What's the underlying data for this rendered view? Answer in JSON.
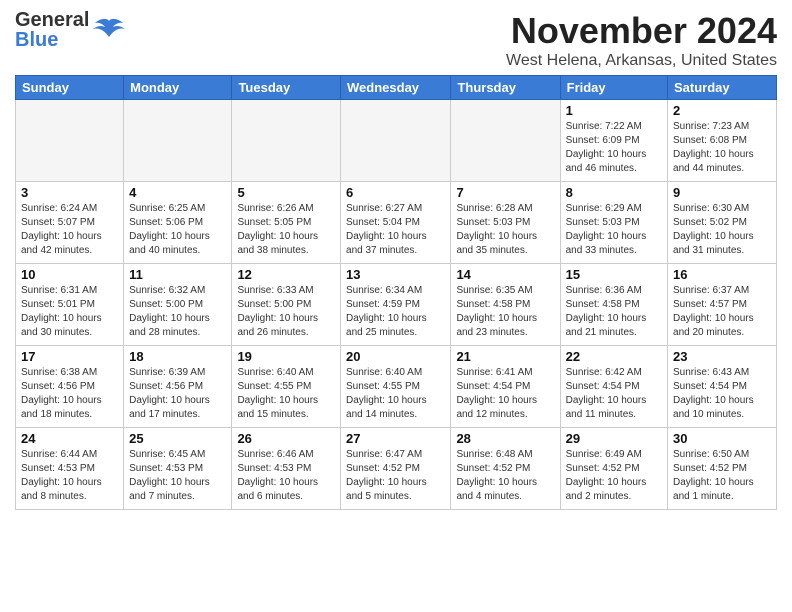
{
  "header": {
    "logo_general": "General",
    "logo_blue": "Blue",
    "month_title": "November 2024",
    "location": "West Helena, Arkansas, United States"
  },
  "weekdays": [
    "Sunday",
    "Monday",
    "Tuesday",
    "Wednesday",
    "Thursday",
    "Friday",
    "Saturday"
  ],
  "weeks": [
    [
      {
        "day": "",
        "empty": true
      },
      {
        "day": "",
        "empty": true
      },
      {
        "day": "",
        "empty": true
      },
      {
        "day": "",
        "empty": true
      },
      {
        "day": "",
        "empty": true
      },
      {
        "day": "1",
        "info": "Sunrise: 7:22 AM\nSunset: 6:09 PM\nDaylight: 10 hours\nand 46 minutes."
      },
      {
        "day": "2",
        "info": "Sunrise: 7:23 AM\nSunset: 6:08 PM\nDaylight: 10 hours\nand 44 minutes."
      }
    ],
    [
      {
        "day": "3",
        "info": "Sunrise: 6:24 AM\nSunset: 5:07 PM\nDaylight: 10 hours\nand 42 minutes."
      },
      {
        "day": "4",
        "info": "Sunrise: 6:25 AM\nSunset: 5:06 PM\nDaylight: 10 hours\nand 40 minutes."
      },
      {
        "day": "5",
        "info": "Sunrise: 6:26 AM\nSunset: 5:05 PM\nDaylight: 10 hours\nand 38 minutes."
      },
      {
        "day": "6",
        "info": "Sunrise: 6:27 AM\nSunset: 5:04 PM\nDaylight: 10 hours\nand 37 minutes."
      },
      {
        "day": "7",
        "info": "Sunrise: 6:28 AM\nSunset: 5:03 PM\nDaylight: 10 hours\nand 35 minutes."
      },
      {
        "day": "8",
        "info": "Sunrise: 6:29 AM\nSunset: 5:03 PM\nDaylight: 10 hours\nand 33 minutes."
      },
      {
        "day": "9",
        "info": "Sunrise: 6:30 AM\nSunset: 5:02 PM\nDaylight: 10 hours\nand 31 minutes."
      }
    ],
    [
      {
        "day": "10",
        "info": "Sunrise: 6:31 AM\nSunset: 5:01 PM\nDaylight: 10 hours\nand 30 minutes."
      },
      {
        "day": "11",
        "info": "Sunrise: 6:32 AM\nSunset: 5:00 PM\nDaylight: 10 hours\nand 28 minutes."
      },
      {
        "day": "12",
        "info": "Sunrise: 6:33 AM\nSunset: 5:00 PM\nDaylight: 10 hours\nand 26 minutes."
      },
      {
        "day": "13",
        "info": "Sunrise: 6:34 AM\nSunset: 4:59 PM\nDaylight: 10 hours\nand 25 minutes."
      },
      {
        "day": "14",
        "info": "Sunrise: 6:35 AM\nSunset: 4:58 PM\nDaylight: 10 hours\nand 23 minutes."
      },
      {
        "day": "15",
        "info": "Sunrise: 6:36 AM\nSunset: 4:58 PM\nDaylight: 10 hours\nand 21 minutes."
      },
      {
        "day": "16",
        "info": "Sunrise: 6:37 AM\nSunset: 4:57 PM\nDaylight: 10 hours\nand 20 minutes."
      }
    ],
    [
      {
        "day": "17",
        "info": "Sunrise: 6:38 AM\nSunset: 4:56 PM\nDaylight: 10 hours\nand 18 minutes."
      },
      {
        "day": "18",
        "info": "Sunrise: 6:39 AM\nSunset: 4:56 PM\nDaylight: 10 hours\nand 17 minutes."
      },
      {
        "day": "19",
        "info": "Sunrise: 6:40 AM\nSunset: 4:55 PM\nDaylight: 10 hours\nand 15 minutes."
      },
      {
        "day": "20",
        "info": "Sunrise: 6:40 AM\nSunset: 4:55 PM\nDaylight: 10 hours\nand 14 minutes."
      },
      {
        "day": "21",
        "info": "Sunrise: 6:41 AM\nSunset: 4:54 PM\nDaylight: 10 hours\nand 12 minutes."
      },
      {
        "day": "22",
        "info": "Sunrise: 6:42 AM\nSunset: 4:54 PM\nDaylight: 10 hours\nand 11 minutes."
      },
      {
        "day": "23",
        "info": "Sunrise: 6:43 AM\nSunset: 4:54 PM\nDaylight: 10 hours\nand 10 minutes."
      }
    ],
    [
      {
        "day": "24",
        "info": "Sunrise: 6:44 AM\nSunset: 4:53 PM\nDaylight: 10 hours\nand 8 minutes."
      },
      {
        "day": "25",
        "info": "Sunrise: 6:45 AM\nSunset: 4:53 PM\nDaylight: 10 hours\nand 7 minutes."
      },
      {
        "day": "26",
        "info": "Sunrise: 6:46 AM\nSunset: 4:53 PM\nDaylight: 10 hours\nand 6 minutes."
      },
      {
        "day": "27",
        "info": "Sunrise: 6:47 AM\nSunset: 4:52 PM\nDaylight: 10 hours\nand 5 minutes."
      },
      {
        "day": "28",
        "info": "Sunrise: 6:48 AM\nSunset: 4:52 PM\nDaylight: 10 hours\nand 4 minutes."
      },
      {
        "day": "29",
        "info": "Sunrise: 6:49 AM\nSunset: 4:52 PM\nDaylight: 10 hours\nand 2 minutes."
      },
      {
        "day": "30",
        "info": "Sunrise: 6:50 AM\nSunset: 4:52 PM\nDaylight: 10 hours\nand 1 minute."
      }
    ]
  ]
}
